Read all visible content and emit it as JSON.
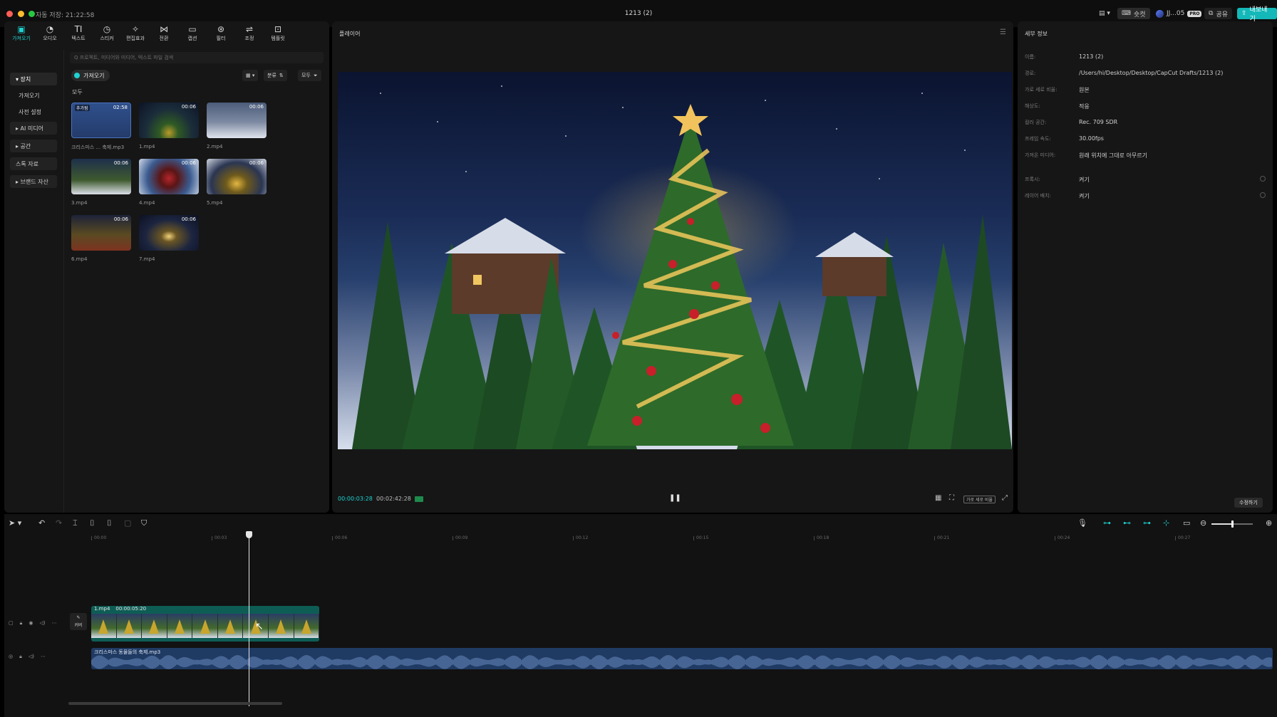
{
  "titlebar": {
    "autosave": "자동 저장: 21:22:58",
    "title": "1213 (2)",
    "shortcut_label": "숏컷",
    "user_label": "JJ...05",
    "pro_badge": "PRO",
    "share_label": "공유",
    "export_label": "내보내기"
  },
  "toolbar_tabs": [
    {
      "label": "가져오기",
      "icon": "import-icon"
    },
    {
      "label": "오디오",
      "icon": "audio-icon"
    },
    {
      "label": "텍스트",
      "icon": "text-icon"
    },
    {
      "label": "스티커",
      "icon": "sticker-icon"
    },
    {
      "label": "편집효과",
      "icon": "effects-icon"
    },
    {
      "label": "전환",
      "icon": "transition-icon"
    },
    {
      "label": "캡션",
      "icon": "caption-icon"
    },
    {
      "label": "필터",
      "icon": "filter-icon"
    },
    {
      "label": "조정",
      "icon": "adjust-icon"
    },
    {
      "label": "템플릿",
      "icon": "template-icon"
    }
  ],
  "side_nav": [
    {
      "label": "▾ 장치"
    },
    {
      "label": "가져오기"
    },
    {
      "label": "사전 설정"
    },
    {
      "label": "▸ AI 미디어"
    },
    {
      "label": "▸ 공간"
    },
    {
      "label": "스톡 자료"
    },
    {
      "label": "▸ 브랜드 자산"
    }
  ],
  "media": {
    "search_placeholder": "Q 프로젝트, 미디어와 미디어, 텍스트 파일 검색",
    "import_label": "가져오기",
    "sort_label": "분류",
    "filter_label": "모두",
    "section_label": "모두",
    "items": [
      {
        "name": "크리스마스 ... 축제.mp3",
        "duration": "02:58",
        "badge": "추가됨"
      },
      {
        "name": "1.mp4",
        "duration": "00:06"
      },
      {
        "name": "2.mp4",
        "duration": "00:06"
      },
      {
        "name": "3.mp4",
        "duration": "00:06"
      },
      {
        "name": "4.mp4",
        "duration": "00:06"
      },
      {
        "name": "5.mp4",
        "duration": "00:06"
      },
      {
        "name": "6.mp4",
        "duration": "00:06"
      },
      {
        "name": "7.mp4",
        "duration": "00:06"
      }
    ]
  },
  "player": {
    "title": "플레이어",
    "current_time": "00:00:03:28",
    "total_time": "00:02:42:28",
    "ratio_label": "가로 세로 비율"
  },
  "details": {
    "title": "세부 정보",
    "rows": [
      {
        "key": "이름:",
        "value": "1213 (2)"
      },
      {
        "key": "경로:",
        "value": "/Users/hi/Desktop/Desktop/CapCut Drafts/1213 (2)"
      },
      {
        "key": "가로 세로 비율:",
        "value": "원본"
      },
      {
        "key": "해상도:",
        "value": "적응"
      },
      {
        "key": "컬러 공간:",
        "value": "Rec. 709 SDR"
      },
      {
        "key": "프레임 속도:",
        "value": "30.00fps"
      },
      {
        "key": "가져온 미디어:",
        "value": "원래 위치에 그대로 아무르기"
      },
      {
        "key": "프록시:",
        "value": "켜기"
      },
      {
        "key": "레이어 배치:",
        "value": "켜기"
      }
    ],
    "edit_label": "수정하기"
  },
  "timeline": {
    "ticks": [
      "00:00",
      "00:03",
      "00:06",
      "00:09",
      "00:12",
      "00:15",
      "00:18",
      "00:21",
      "00:24",
      "00:27"
    ],
    "cover_label": "커버",
    "video_clip": {
      "name": "1.mp4",
      "duration": "00:00:05:20"
    },
    "audio_clip": {
      "name": "크리스마스 동물들의 축제.mp3"
    }
  }
}
